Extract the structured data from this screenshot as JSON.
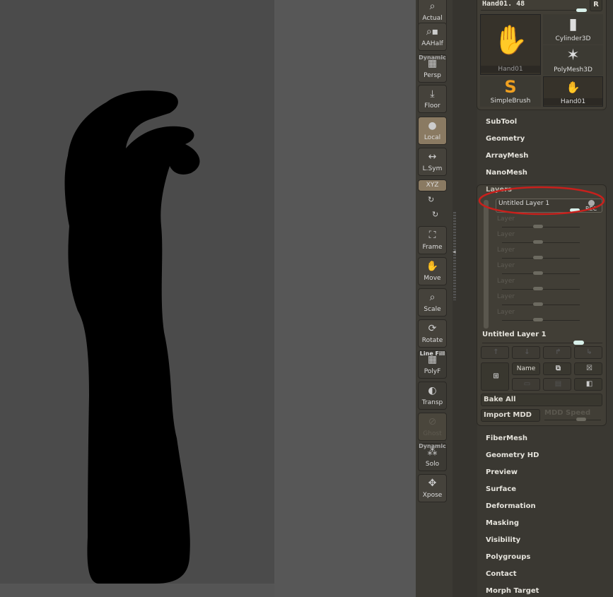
{
  "toolbar": {
    "actual": "Actual",
    "aahalf": "AAHalf",
    "persp": "Persp",
    "persp_top": "Dynamic",
    "floor": "Floor",
    "local": "Local",
    "lsym": "L.Sym",
    "xyz": "XYZ",
    "frame": "Frame",
    "move": "Move",
    "scale": "Scale",
    "rotate": "Rotate",
    "polyf": "PolyF",
    "polyf_top": "Line Fill",
    "transp": "Transp",
    "ghost": "Ghost",
    "solo": "Solo",
    "solo_top": "Dynamic",
    "xpose": "Xpose"
  },
  "tool": {
    "name": "Hand01. 48",
    "r_button": "R",
    "thumbs": [
      "Hand01",
      "Cylinder3D",
      "PolyMesh3D",
      "SimpleBrush",
      "Hand01"
    ]
  },
  "menus_top": [
    "SubTool",
    "Geometry",
    "ArrayMesh",
    "NanoMesh"
  ],
  "layers": {
    "title": "Layers",
    "active_layer": "Untitled Layer 1",
    "rec": "REC",
    "empty_layers": [
      "Layer",
      "Layer",
      "Layer",
      "Layer",
      "Layer",
      "Layer",
      "Layer"
    ],
    "selected_name": "Untitled Layer 1",
    "name_btn": "Name",
    "bake_all": "Bake All",
    "import_mdd": "Import MDD",
    "mdd_speed": "MDD Speed"
  },
  "menus_bottom": [
    "FiberMesh",
    "Geometry HD",
    "Preview",
    "Surface",
    "Deformation",
    "Masking",
    "Visibility",
    "Polygroups",
    "Contact",
    "Morph Target"
  ],
  "colors": {
    "annotation": "#c8201c",
    "slider_knob": "#d8f0ea"
  }
}
